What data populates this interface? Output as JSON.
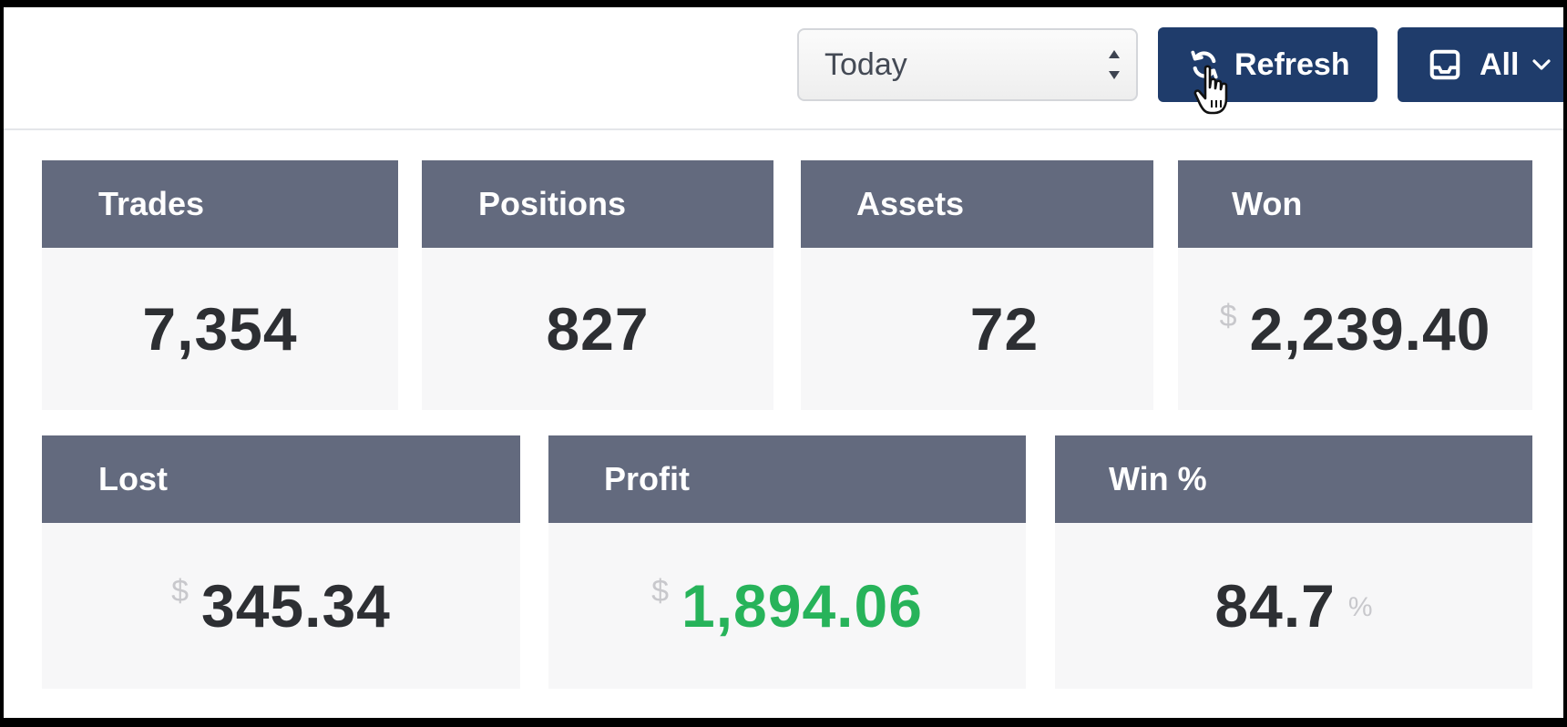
{
  "toolbar": {
    "period_select": {
      "selected": "Today"
    },
    "refresh_label": "Refresh",
    "view_label": "All"
  },
  "stats": {
    "trades": {
      "label": "Trades",
      "value": "7,354"
    },
    "positions": {
      "label": "Positions",
      "value": "827"
    },
    "assets": {
      "label": "Assets",
      "value": "72"
    },
    "won": {
      "label": "Won",
      "currency": "$",
      "value": "2,239.40"
    },
    "lost": {
      "label": "Lost",
      "currency": "$",
      "value": "345.34"
    },
    "profit": {
      "label": "Profit",
      "currency": "$",
      "value": "1,894.06"
    },
    "win_pct": {
      "label": "Win %",
      "value": "84.7",
      "unit": "%"
    }
  },
  "colors": {
    "header_bg": "#636a7e",
    "button_bg": "#1f3c6b",
    "profit_green": "#27b35a",
    "value_text": "#2d2f33"
  },
  "icons": {
    "refresh": "refresh-icon",
    "view": "tray-icon",
    "dropdown": "chevron-down-icon",
    "cursor": "hand-pointer-icon",
    "select_arrows": "up-down-arrows-icon"
  }
}
